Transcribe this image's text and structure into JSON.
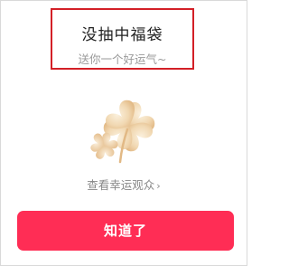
{
  "dialog": {
    "title": "没抽中福袋",
    "subtitle": "送你一个好运气~",
    "illustration_icon": "four-leaf-clover-icon",
    "link_label": "查看幸运观众",
    "link_chevron": "›",
    "confirm_label": "知道了"
  },
  "colors": {
    "accent": "#ff2d55",
    "highlight_box": "#d32027",
    "clover": "#f1d8b2"
  }
}
